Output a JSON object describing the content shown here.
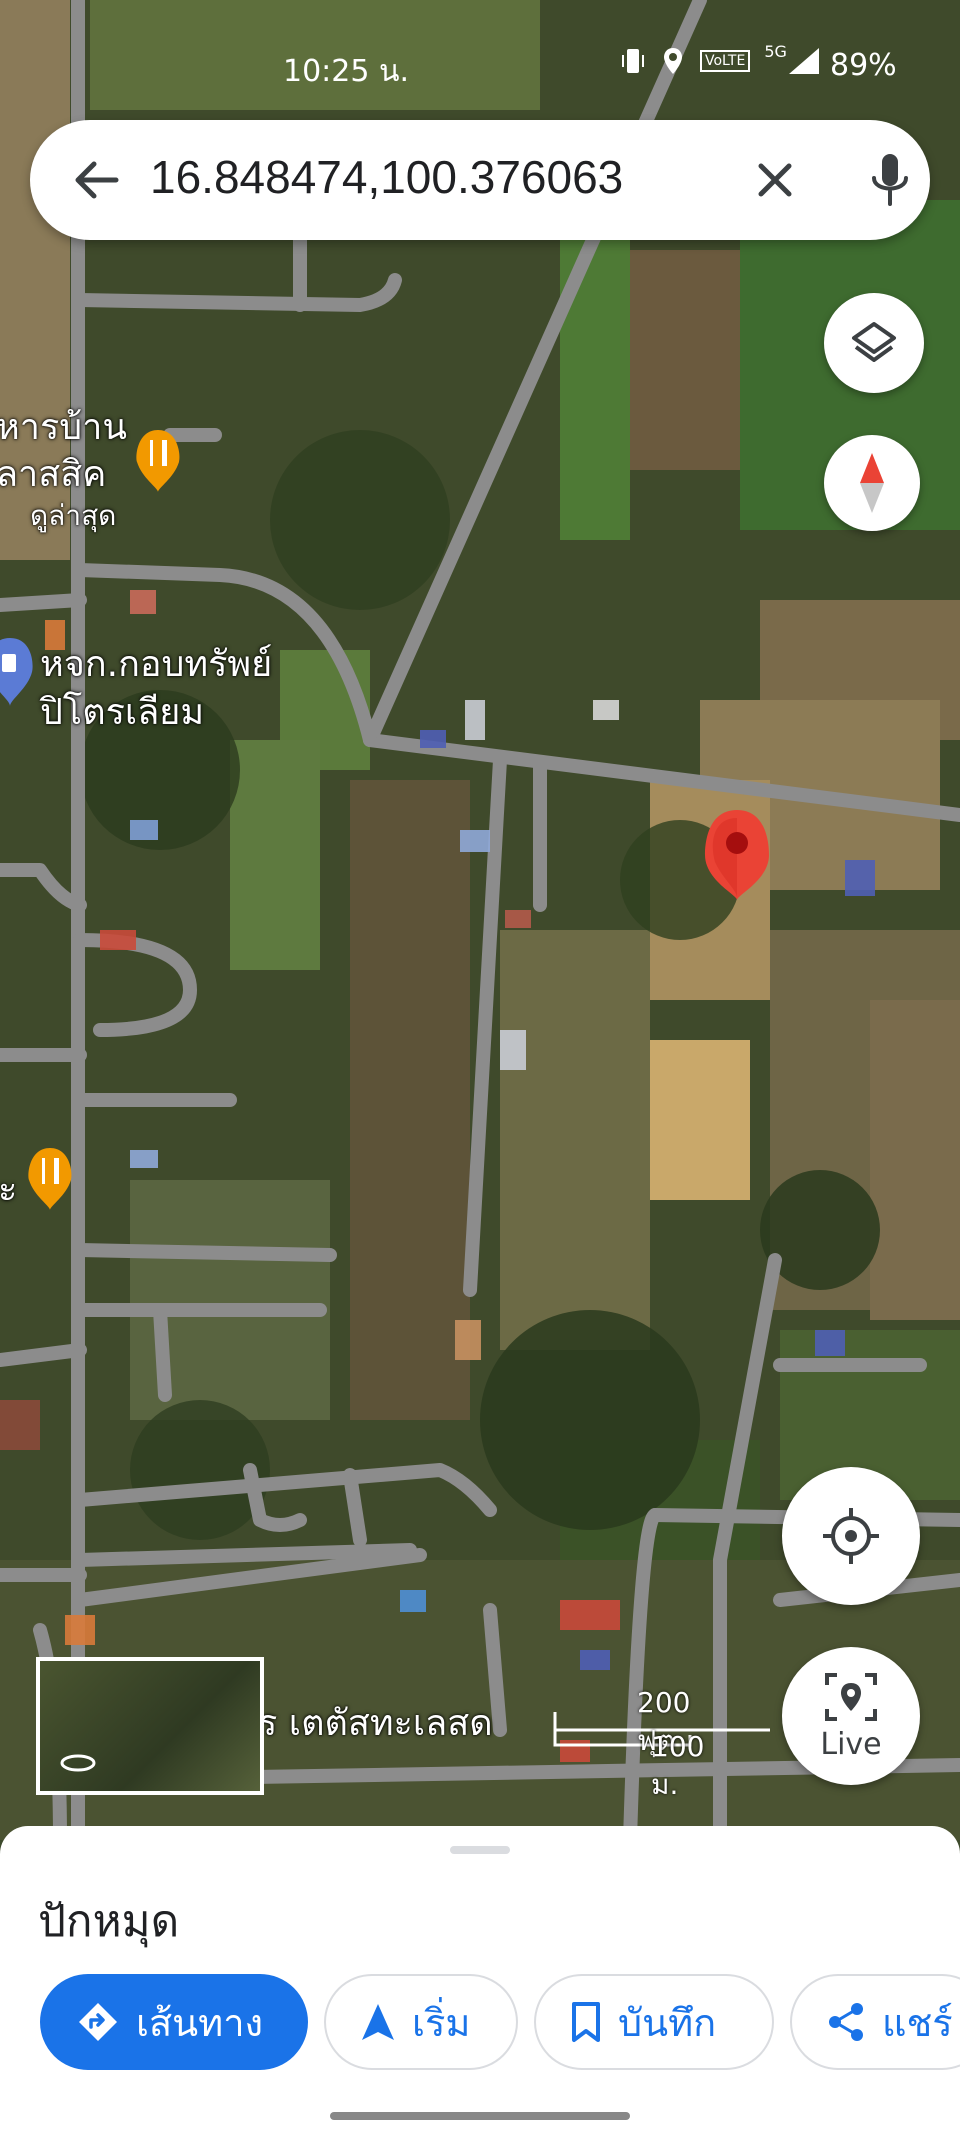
{
  "status_bar": {
    "time": "10:25 น.",
    "battery": "89%",
    "network": "5G",
    "volte": "VoLTE"
  },
  "search": {
    "query": "16.848474,100.376063"
  },
  "map": {
    "labels": {
      "restaurant_1": "หารบ้าน",
      "restaurant_1_line2": "ลาสสิค",
      "restaurant_1_sub": "ดูล่าสุด",
      "gas_station": "หจก.กอบทรัพย์",
      "gas_station_line2": "ปิโตรเลียม",
      "restaurant_2": "ะ",
      "seafood": "ร เตตัสทะเลสด"
    },
    "scale": {
      "feet": "200 ฟุต",
      "meters": "100 ม."
    },
    "live_label": "Live"
  },
  "bottom_sheet": {
    "title": "ปักหมุด",
    "actions": {
      "directions": "เส้นทาง",
      "start": "เริ่ม",
      "save": "บันทึก",
      "share": "แชร์"
    }
  },
  "colors": {
    "accent": "#1a73e8",
    "pin": "#ea4335",
    "poi": "#f29900"
  }
}
